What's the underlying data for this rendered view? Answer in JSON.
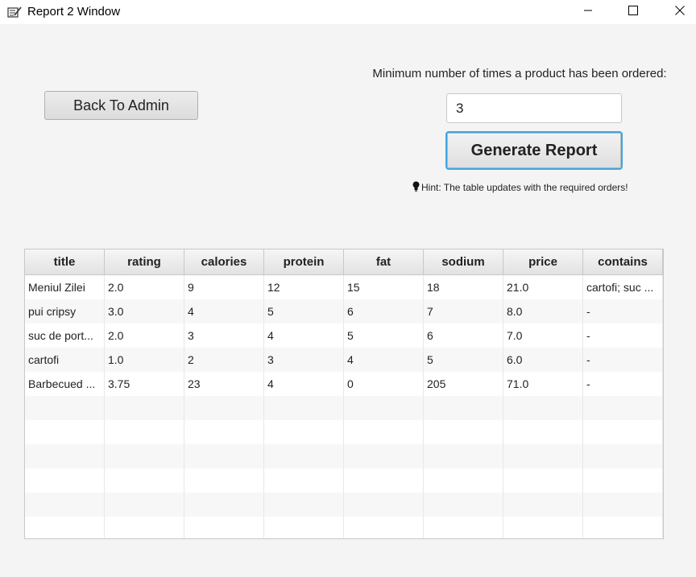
{
  "window": {
    "title": "Report 2 Window"
  },
  "back_button": {
    "label": "Back To Admin"
  },
  "filter": {
    "label": "Minimum number of times a product has been ordered:",
    "value": "3"
  },
  "generate_button": {
    "label": "Generate Report"
  },
  "hint": {
    "text": "Hint: The table updates with the required orders!"
  },
  "table": {
    "columns": [
      "title",
      "rating",
      "calories",
      "protein",
      "fat",
      "sodium",
      "price",
      "contains"
    ],
    "rows": [
      [
        "Meniul Zilei",
        "2.0",
        "9",
        "12",
        "15",
        "18",
        "21.0",
        "cartofi; suc ..."
      ],
      [
        "pui cripsy",
        "3.0",
        "4",
        "5",
        "6",
        "7",
        "8.0",
        "-"
      ],
      [
        "suc de port...",
        "2.0",
        "3",
        "4",
        "5",
        "6",
        "7.0",
        "-"
      ],
      [
        "cartofi",
        "1.0",
        "2",
        "3",
        "4",
        "5",
        "6.0",
        "-"
      ],
      [
        "Barbecued ...",
        "3.75",
        "23",
        "4",
        "0",
        "205",
        "71.0",
        "-"
      ]
    ],
    "empty_rows": 6
  },
  "colors": {
    "focus_border": "#3fa6e3",
    "background": "#f4f4f4"
  }
}
